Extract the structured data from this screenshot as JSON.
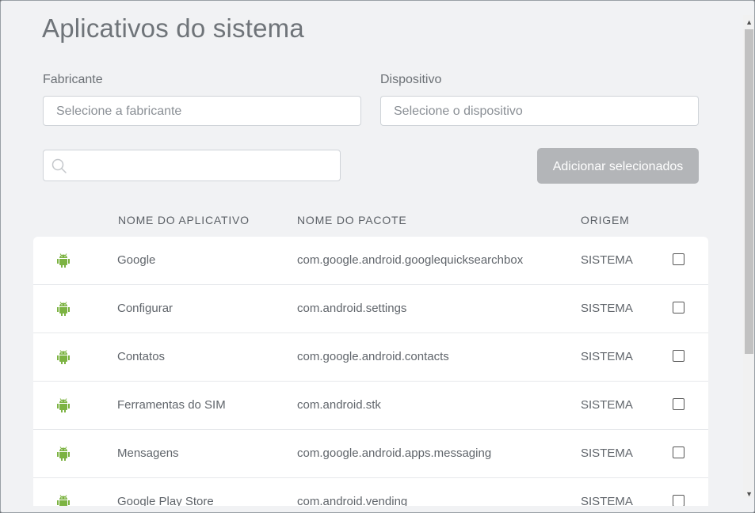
{
  "dialog": {
    "title": "Aplicativos do sistema"
  },
  "filters": {
    "manufacturer": {
      "label": "Fabricante",
      "placeholder": "Selecione a fabricante"
    },
    "device": {
      "label": "Dispositivo",
      "placeholder": "Selecione o dispositivo"
    }
  },
  "search": {
    "placeholder": "",
    "icon": "search-icon"
  },
  "actions": {
    "add_selected": "Adicionar selecionados"
  },
  "table": {
    "headers": {
      "app_name": "NOME DO APLICATIVO",
      "package_name": "NOME DO PACOTE",
      "origin": "ORIGEM"
    },
    "rows": [
      {
        "name": "Google",
        "package": "com.google.android.googlequicksearchbox",
        "origin": "SISTEMA",
        "checked": false,
        "icon": "android-icon"
      },
      {
        "name": "Configurar",
        "package": "com.android.settings",
        "origin": "SISTEMA",
        "checked": false,
        "icon": "android-icon"
      },
      {
        "name": "Contatos",
        "package": "com.google.android.contacts",
        "origin": "SISTEMA",
        "checked": false,
        "icon": "android-icon"
      },
      {
        "name": "Ferramentas do SIM",
        "package": "com.android.stk",
        "origin": "SISTEMA",
        "checked": false,
        "icon": "android-icon"
      },
      {
        "name": "Mensagens",
        "package": "com.google.android.apps.messaging",
        "origin": "SISTEMA",
        "checked": false,
        "icon": "android-icon"
      },
      {
        "name": "Google Play Store",
        "package": "com.android.vending",
        "origin": "SISTEMA",
        "checked": false,
        "icon": "android-icon"
      }
    ]
  },
  "colors": {
    "android_green": "#7cb342",
    "button_disabled": "#b3b5b8",
    "background": "#f1f2f4"
  }
}
